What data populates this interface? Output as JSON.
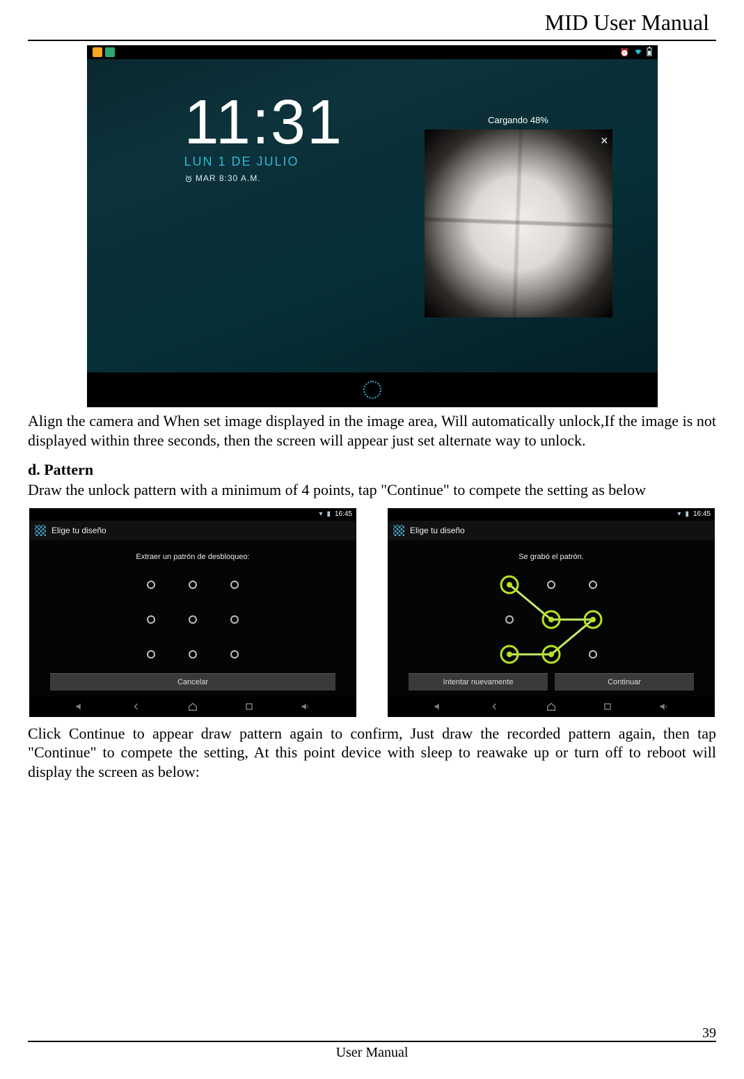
{
  "header": {
    "title": "MID User Manual"
  },
  "lockscreen": {
    "time": "11:31",
    "date": "LUN 1 DE JULIO",
    "alarm_label": "MAR 8:30 A.M.",
    "loading_label": "Cargando 48%",
    "close_label": "×",
    "status_right": {
      "alarm": "⏰",
      "wifi": "▾",
      "batt": "▮"
    }
  },
  "para_align": "Align the camera and When set image displayed in the image area, Will automatically unlock,If the image is not displayed within three seconds, then the screen will appear just set alternate way to unlock.",
  "section_d": {
    "heading": "d. Pattern",
    "intro": "Draw the unlock pattern with a minimum of 4 points, tap \"Continue\" to compete the setting as below"
  },
  "pattern_left": {
    "status_time": "16:45",
    "title": "Elige tu diseño",
    "hint": "Extraer un patrón de desbloqueo:",
    "buttons": {
      "cancel": "Cancelar"
    }
  },
  "pattern_right": {
    "status_time": "16:45",
    "title": "Elige tu diseño",
    "hint": "Se grabó el patrón.",
    "buttons": {
      "retry": "Intentar nuevamente",
      "continue": "Continuar"
    }
  },
  "para_continue": "Click Continue to appear draw pattern again to confirm, Just draw the recorded pattern again, then tap \"Continue\" to compete the setting, At this point device with sleep to reawake up or turn off to reboot will display the screen as below:",
  "footer": {
    "page_number": "39",
    "label": "User Manual"
  }
}
